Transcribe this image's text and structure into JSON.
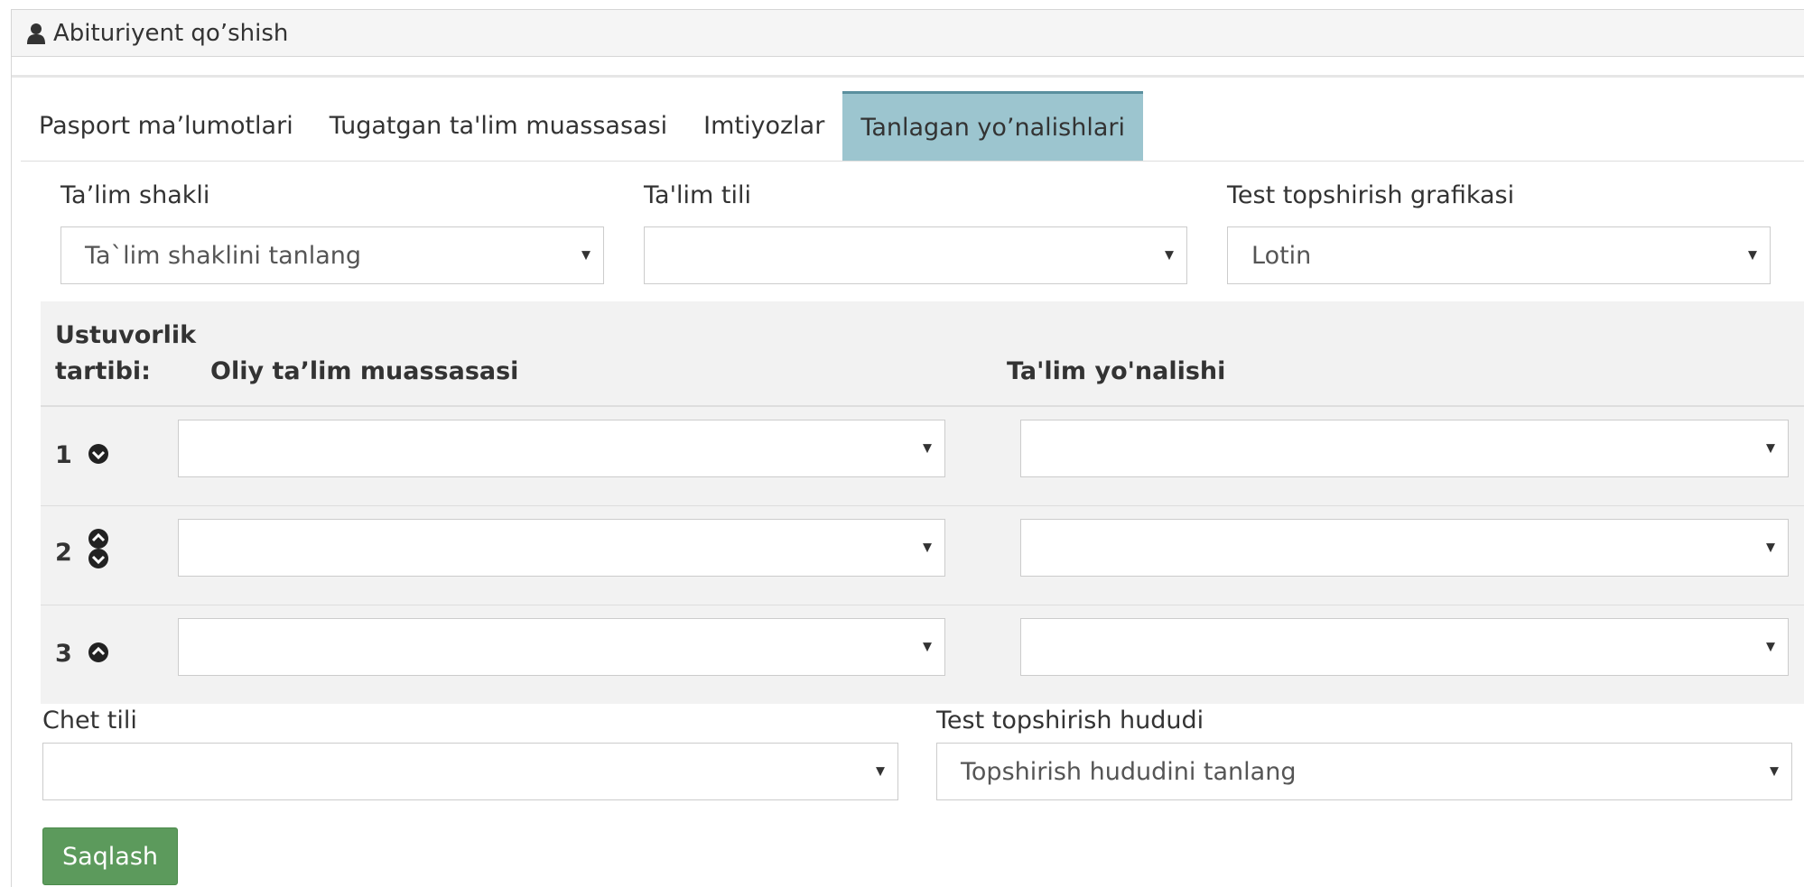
{
  "panel": {
    "title": "Abituriyent qo’shish",
    "icon": "user-icon"
  },
  "tabs": [
    {
      "label": "Pasport ma’lumotlari",
      "active": false
    },
    {
      "label": "Tugatgan ta'lim muassasasi",
      "active": false
    },
    {
      "label": "Imtiyozlar",
      "active": false
    },
    {
      "label": "Tanlagan yo’nalishlari",
      "active": true
    }
  ],
  "form": {
    "talim_shakli": {
      "label": "Ta’lim shakli",
      "value": "Ta`lim shaklini tanlang"
    },
    "talim_tili": {
      "label": "Ta'lim tili",
      "value": ""
    },
    "test_grafik": {
      "label": "Test topshirish grafikasi",
      "value": "Lotin"
    },
    "chet_tili": {
      "label": "Chet tili",
      "value": ""
    },
    "test_hudud": {
      "label": "Test topshirish hududi",
      "value": "Topshirish hududini tanlang"
    }
  },
  "table": {
    "headers": {
      "priority_line1": "Ustuvorlik",
      "priority_line2": "tartibi:",
      "institution": "Oliy ta’lim muassasasi",
      "direction": "Ta'lim yo'nalishi"
    },
    "rows": [
      {
        "priority": "1",
        "institution": "",
        "direction": "",
        "arrows": [
          "down"
        ]
      },
      {
        "priority": "2",
        "institution": "",
        "direction": "",
        "arrows": [
          "up",
          "down"
        ]
      },
      {
        "priority": "3",
        "institution": "",
        "direction": "",
        "arrows": [
          "up"
        ]
      }
    ]
  },
  "actions": {
    "save_label": "Saqlash"
  },
  "colors": {
    "active_tab": "#9cc5cf",
    "save_button": "#5c9a5c"
  }
}
